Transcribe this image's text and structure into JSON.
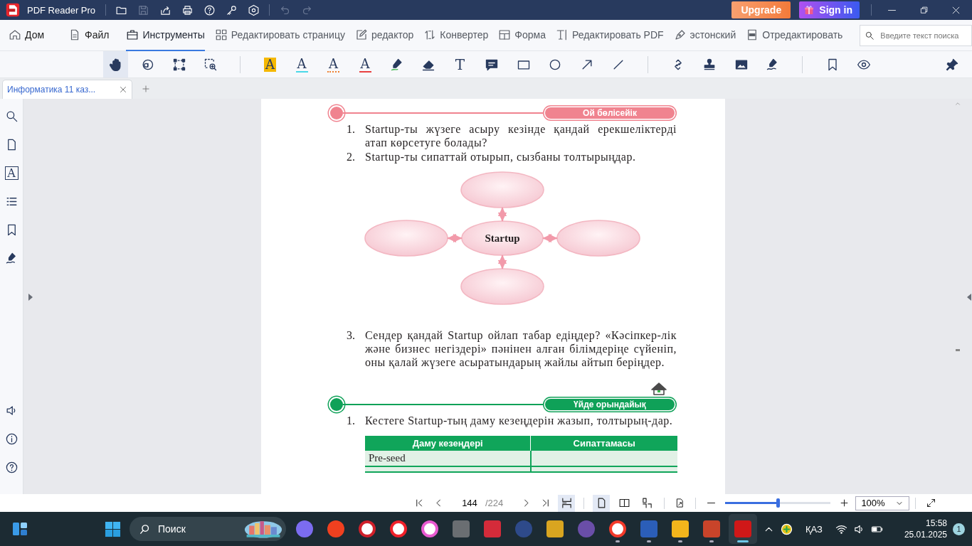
{
  "title_bar": {
    "app_name": "PDF Reader Pro",
    "upgrade": "Upgrade",
    "sign_in": "Sign in"
  },
  "ribbon": {
    "tabs": [
      {
        "label": "Дом",
        "selected": false
      },
      {
        "label": "Файл",
        "selected": false
      },
      {
        "label": "Инструменты",
        "selected": true
      },
      {
        "label": "Редактировать страницу",
        "selected": false
      },
      {
        "label": "редактор",
        "selected": false
      },
      {
        "label": "Конвертер",
        "selected": false
      },
      {
        "label": "Форма",
        "selected": false
      },
      {
        "label": "Редактировать PDF",
        "selected": false
      },
      {
        "label": "эстонский",
        "selected": false
      },
      {
        "label": "Отредактировать",
        "selected": false
      }
    ],
    "search": {
      "placeholder": "Введите текст поиска"
    }
  },
  "toolbar": {
    "groups": [
      [
        {
          "kind": "hand",
          "selected": true
        },
        {
          "kind": "text-select",
          "selected": false
        },
        {
          "kind": "area-select",
          "selected": false
        },
        {
          "kind": "zoom-area",
          "selected": false
        }
      ],
      [
        {
          "kind": "highlight",
          "glyph": "A",
          "selected": false
        },
        {
          "kind": "underline",
          "glyph": "A",
          "selected": false
        },
        {
          "kind": "squiggly",
          "glyph": "A",
          "selected": false
        },
        {
          "kind": "strikeout",
          "glyph": "A",
          "selected": false
        },
        {
          "kind": "marker",
          "selected": false
        },
        {
          "kind": "eraser",
          "selected": false
        },
        {
          "kind": "text",
          "glyph": "T",
          "selected": false
        },
        {
          "kind": "note",
          "selected": false
        },
        {
          "kind": "rectangle",
          "selected": false
        },
        {
          "kind": "ellipse",
          "selected": false
        },
        {
          "kind": "arrow",
          "selected": false
        },
        {
          "kind": "line",
          "selected": false
        }
      ],
      [
        {
          "kind": "link",
          "selected": false
        },
        {
          "kind": "stamp",
          "selected": false
        },
        {
          "kind": "image",
          "selected": false
        },
        {
          "kind": "signature",
          "selected": false
        }
      ],
      [
        {
          "kind": "bookmark",
          "selected": false
        },
        {
          "kind": "eye",
          "selected": false
        }
      ]
    ]
  },
  "document_tabs": [
    {
      "label": "Информатика 11 каз...",
      "selected": true
    }
  ],
  "sidebar": {
    "top": [
      {
        "kind": "search"
      },
      {
        "kind": "pages"
      },
      {
        "kind": "text",
        "glyph": "A"
      },
      {
        "kind": "list"
      },
      {
        "kind": "bookmark"
      },
      {
        "kind": "signature"
      }
    ],
    "bottom": [
      {
        "kind": "speaker"
      },
      {
        "kind": "info"
      },
      {
        "kind": "help"
      }
    ]
  },
  "page": {
    "blocks": [
      {
        "kind": "header",
        "title": "Ой бөлісейік",
        "color": "#f0838f",
        "home_icon": false
      },
      {
        "kind": "item",
        "number": "1.",
        "text": "Startup-ты жүзеге асыру кезінде қандай ерекшеліктерді атап көрсетуге болады?"
      },
      {
        "kind": "item",
        "number": "2.",
        "text": "Startup-ты сипаттай отырып, сызбаны толтырыңдар."
      },
      {
        "kind": "diagram",
        "center": "Startup"
      },
      {
        "kind": "item",
        "number": "3.",
        "text": "Сендер қандай Startup ойлап табар едіңдер? «Кәсіпкер-лік және бизнес негіздері» пәнінен алған білімдеріңе сүйеніп, оны қалай жүзеге асыратындарың жайлы айтып беріңдер."
      },
      {
        "kind": "header",
        "title": "Үйде орындайық",
        "color": "#0fa158",
        "home_icon": true
      },
      {
        "kind": "item",
        "number": "1.",
        "text": "Кестеге Startup-тың даму кезеңдерін жазып, толтырың-дар."
      },
      {
        "kind": "table",
        "columns": [
          "Даму кезеңдері",
          "Сипаттамасы"
        ],
        "rows": [
          [
            "Pre-seed"
          ]
        ]
      }
    ]
  },
  "status_bar": {
    "page": "144",
    "total": "/224",
    "zoom": "100%",
    "level": 0.49,
    "view_buttons": [
      {
        "kind": "scroll",
        "selected": true
      },
      {
        "kind": "single",
        "selected": true
      },
      {
        "kind": "double",
        "selected": false
      },
      {
        "kind": "cover",
        "selected": false
      }
    ]
  },
  "taskbar": {
    "search_label": "Поиск",
    "language": "ҚАЗ",
    "time": "15:58",
    "date": "25.01.2025",
    "notifications": "1",
    "apps": [
      {
        "kind": "circle",
        "color": "#7b6cf0",
        "running": false,
        "selected": false
      },
      {
        "kind": "circle",
        "color": "#f0401f",
        "running": false,
        "selected": false
      },
      {
        "kind": "ring",
        "color": "#d0202a",
        "running": false,
        "selected": false
      },
      {
        "kind": "ring",
        "color": "#f0202a",
        "running": false,
        "selected": false
      },
      {
        "kind": "ring",
        "color": "#e85ad0",
        "running": false,
        "selected": false
      },
      {
        "kind": "square",
        "color": "#6a6e72",
        "running": false,
        "selected": false
      },
      {
        "kind": "square",
        "color": "#d42b3a",
        "running": false,
        "selected": false
      },
      {
        "kind": "circle",
        "color": "#2e4a8a",
        "running": false,
        "selected": false
      },
      {
        "kind": "square",
        "color": "#d9a520",
        "running": false,
        "selected": false
      },
      {
        "kind": "circle",
        "color": "#6a4ea8",
        "running": false,
        "selected": false
      },
      {
        "kind": "ring",
        "color": "#f33a2a",
        "running": true,
        "selected": false
      },
      {
        "kind": "square",
        "color": "#2b5eb8",
        "running": true,
        "selected": false
      },
      {
        "kind": "square",
        "color": "#f2b51c",
        "running": true,
        "selected": false
      },
      {
        "kind": "square",
        "color": "#c9442a",
        "running": true,
        "selected": false
      },
      {
        "kind": "square",
        "color": "#d01818",
        "running": true,
        "selected": true
      }
    ]
  }
}
